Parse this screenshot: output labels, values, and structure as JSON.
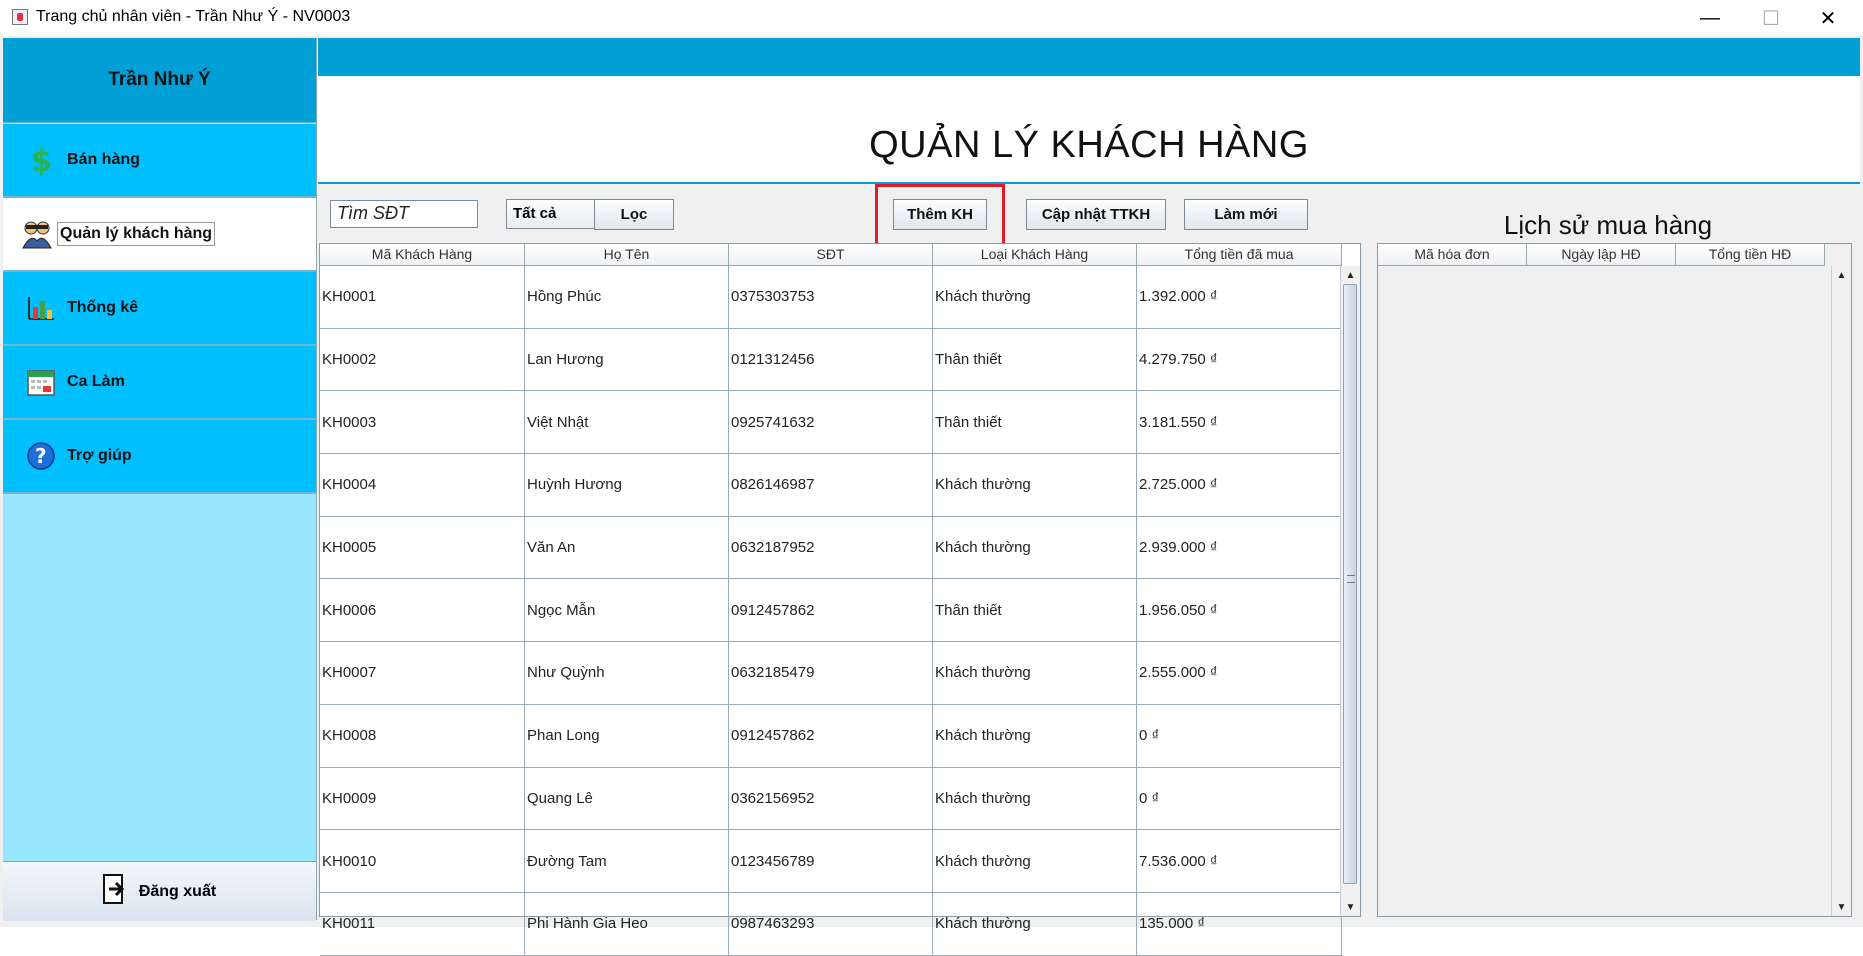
{
  "window": {
    "title": "Trang chủ nhân viên - Trần Như Ý - NV0003",
    "minimize": "—",
    "maximize": "☐",
    "close": "✕"
  },
  "sidebar": {
    "user_name": "Trần Như Ý",
    "items": [
      {
        "label": "Bán hàng",
        "icon": "dollar-icon",
        "active": false
      },
      {
        "label": "Quản lý khách hàng",
        "icon": "customers-icon",
        "active": true
      },
      {
        "label": "Thống kê",
        "icon": "chart-icon",
        "active": false
      },
      {
        "label": "Ca Làm",
        "icon": "calendar-icon",
        "active": false
      },
      {
        "label": "Trợ giúp",
        "icon": "help-icon",
        "active": false
      }
    ],
    "logout_label": "Đăng xuất"
  },
  "main": {
    "page_title": "QUẢN LÝ KHÁCH HÀNG",
    "search": {
      "value": "Tìm SĐT"
    },
    "filter": {
      "selected": "Tất cả"
    },
    "buttons": {
      "filter": "Lọc",
      "add": "Thêm KH",
      "update": "Cập nhật TTKH",
      "refresh": "Làm mới"
    },
    "customers_table": {
      "columns": [
        "Mã Khách Hàng",
        "Họ Tên",
        "SĐT",
        "Loại Khách Hàng",
        "Tổng tiền đã mua"
      ],
      "rows": [
        [
          "KH0001",
          "Hồng Phúc",
          "0375303753",
          "Khách thường",
          "1.392.000 ₫"
        ],
        [
          "KH0002",
          "Lan Hương",
          "0121312456",
          "Thân thiết",
          "4.279.750 ₫"
        ],
        [
          "KH0003",
          "Việt Nhật",
          "0925741632",
          "Thân thiết",
          "3.181.550 ₫"
        ],
        [
          "KH0004",
          "Huỳnh Hương",
          "0826146987",
          "Khách thường",
          "2.725.000 ₫"
        ],
        [
          "KH0005",
          "Văn An",
          "0632187952",
          "Khách thường",
          "2.939.000 ₫"
        ],
        [
          "KH0006",
          "Ngọc Mẫn",
          "0912457862",
          "Thân thiết",
          "1.956.050 ₫"
        ],
        [
          "KH0007",
          "Như Quỳnh",
          "0632185479",
          "Khách thường",
          "2.555.000 ₫"
        ],
        [
          "KH0008",
          "Phan Long",
          "0912457862",
          "Khách thường",
          "0 ₫"
        ],
        [
          "KH0009",
          "Quang Lê",
          "0362156952",
          "Khách thường",
          "0 ₫"
        ],
        [
          "KH0010",
          "Đường Tam",
          "0123456789",
          "Khách thường",
          "7.536.000 ₫"
        ],
        [
          "KH0011",
          "Phi Hành Gia Heo",
          "0987463293",
          "Khách thường",
          "135.000 ₫"
        ]
      ]
    },
    "history": {
      "title": "Lịch sử mua hàng",
      "columns": [
        "Mã hóa đơn",
        "Ngày lập HĐ",
        "Tổng tiền HĐ"
      ]
    }
  },
  "colors": {
    "header_blue": "#00a0d6",
    "menu_blue": "#00bfff",
    "sidebar_light": "#99e6ff",
    "highlight_red": "#e01b24"
  }
}
